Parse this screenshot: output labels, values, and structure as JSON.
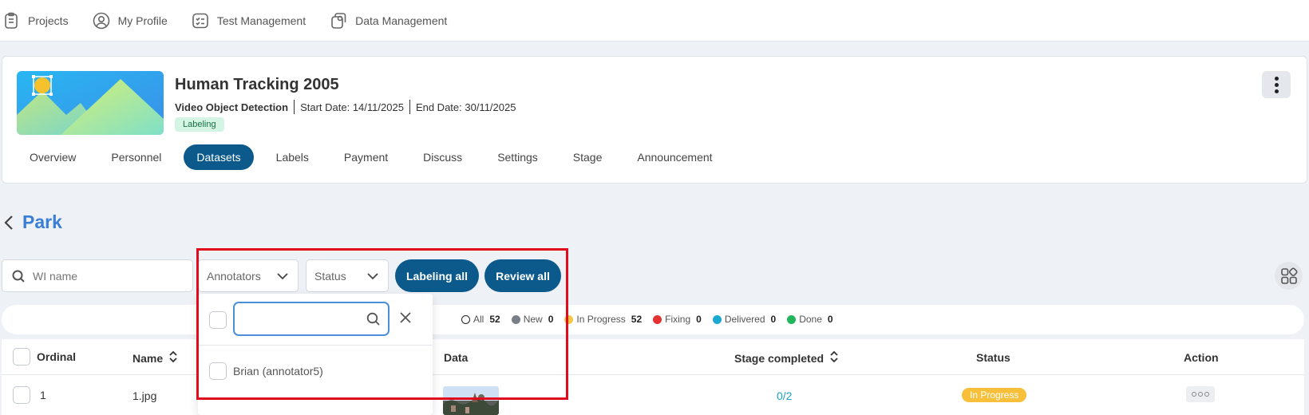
{
  "topnav": {
    "items": [
      {
        "label": "Projects",
        "icon": "clipboard-icon"
      },
      {
        "label": "My Profile",
        "icon": "user-circle-icon"
      },
      {
        "label": "Test Management",
        "icon": "checklist-icon"
      },
      {
        "label": "Data Management",
        "icon": "data-icon"
      }
    ]
  },
  "project": {
    "title": "Human Tracking 2005",
    "type": "Video Object Detection",
    "start_date": "Start Date: 14/11/2025",
    "end_date": "End Date: 30/11/2025",
    "status_badge": "Labeling",
    "tabs": [
      "Overview",
      "Personnel",
      "Datasets",
      "Labels",
      "Payment",
      "Discuss",
      "Settings",
      "Stage",
      "Announcement"
    ],
    "active_tab": "Datasets"
  },
  "dataset": {
    "name": "Park"
  },
  "filters": {
    "search_placeholder": "WI name",
    "annotators_label": "Annotators",
    "status_label": "Status",
    "labeling_all": "Labeling all",
    "review_all": "Review all"
  },
  "legend": {
    "all_label": "All",
    "all_count": "52",
    "new_label": "New",
    "new_count": "0",
    "progress_label": "In Progress",
    "progress_count": "52",
    "fixing_label": "Fixing",
    "fixing_count": "0",
    "delivered_label": "Delivered",
    "delivered_count": "0",
    "done_label": "Done",
    "done_count": "0",
    "colors": {
      "new": "#7a7f87",
      "progress": "#f8c447",
      "fixing": "#e5312f",
      "delivered": "#19a9d2",
      "done": "#21b65e"
    }
  },
  "table": {
    "headers": {
      "ordinal": "Ordinal",
      "name": "Name",
      "data": "Data",
      "stage": "Stage completed",
      "status": "Status",
      "action": "Action"
    },
    "rows": [
      {
        "ordinal": "1",
        "name": "1.jpg",
        "stage": "0/2",
        "status": "In Progress"
      }
    ]
  },
  "dropdown": {
    "search_value": "",
    "options": [
      "Brian (annotator5)"
    ]
  },
  "colors": {
    "primary": "#0c5a8c",
    "accent_link": "#3a7fd5",
    "highlight": "#e00b1c"
  }
}
